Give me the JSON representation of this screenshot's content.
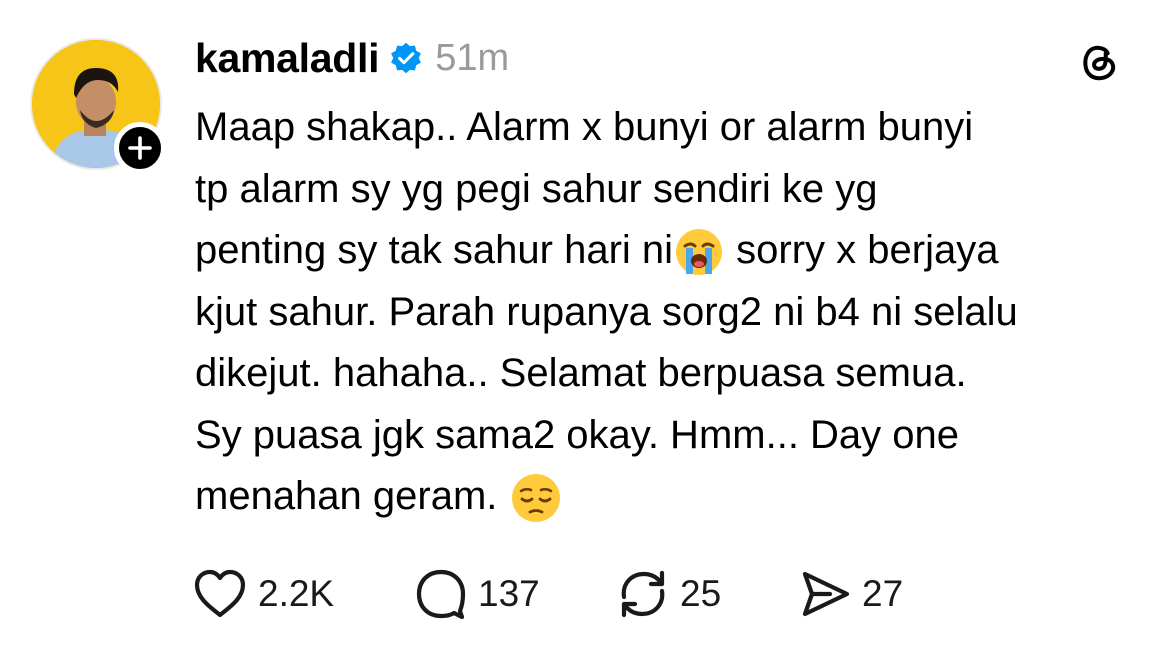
{
  "post": {
    "username": "kamaladli",
    "timestamp": "51m",
    "text_line1": "Maap shakap.. Alarm x bunyi or alarm bunyi",
    "text_line2": "tp alarm sy yg pegi sahur sendiri ke yg",
    "text_line3a": "penting sy tak sahur hari ni",
    "text_line3b": " sorry x berjaya",
    "text_line4": "kjut sahur. Parah rupanya sorg2 ni b4 ni selalu",
    "text_line5": "dikejut. hahaha.. Selamat berpuasa semua.",
    "text_line6": "Sy puasa jgk sama2 okay. Hmm... Day one",
    "text_line7": "menahan geram. ",
    "emojis": [
      "loudly-crying-face",
      "pensive-face"
    ]
  },
  "actions": {
    "likes": "2.2K",
    "replies": "137",
    "reposts": "25",
    "shares": "27"
  },
  "icons": {
    "verified": "verified-badge-icon",
    "app": "threads-logo-icon",
    "follow": "plus-icon",
    "like": "heart-icon",
    "reply": "comment-bubble-icon",
    "repost": "repost-icon",
    "share": "send-icon"
  },
  "colors": {
    "verified_blue": "#0095f6",
    "timestamp_gray": "#9a9a9a",
    "avatar_bg": "#f7c418"
  }
}
